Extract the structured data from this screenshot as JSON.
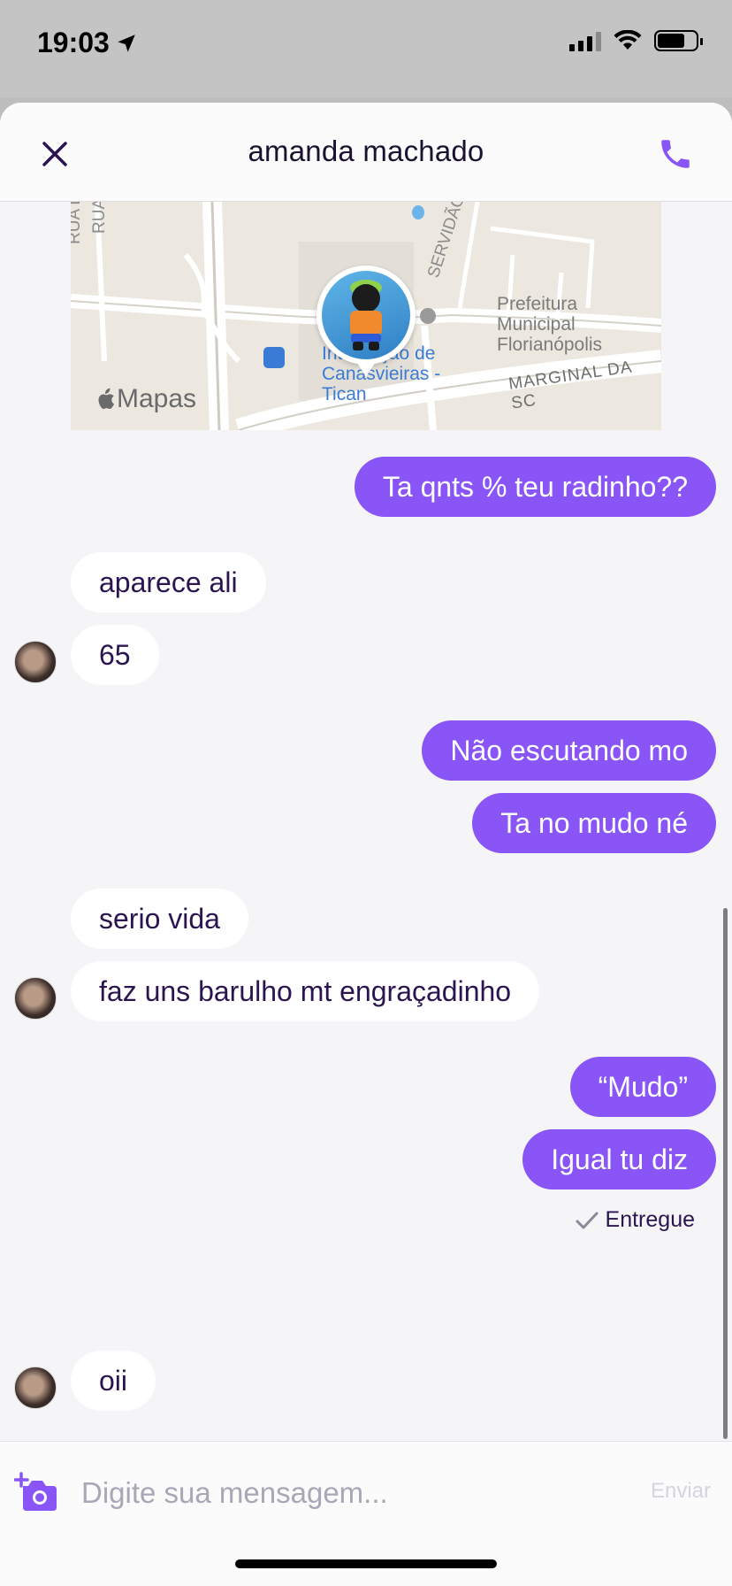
{
  "status_bar": {
    "time": "19:03"
  },
  "header": {
    "title": "amanda machado"
  },
  "map": {
    "streets": [
      "RUA L",
      "RUA",
      "SERVIDÃO B",
      "MARGINAL DA SC"
    ],
    "poi_lines": [
      "Prefeitura",
      "Municipal",
      "Florianópolis"
    ],
    "transit_lines": [
      "Integração de",
      "Canasvieiras -",
      "Tican"
    ],
    "watermark": "Mapas"
  },
  "messages": [
    {
      "side": "out",
      "text": "Ta qnts % teu radinho??"
    },
    {
      "side": "in",
      "text": "aparece ali"
    },
    {
      "side": "in",
      "text": "65"
    },
    {
      "side": "out",
      "text": "Não escutando mo"
    },
    {
      "side": "out",
      "text": "Ta no mudo né"
    },
    {
      "side": "in",
      "text": "serio vida"
    },
    {
      "side": "in",
      "text": "faz uns barulho mt engraçadinho"
    },
    {
      "side": "out",
      "text": "“Mudo”"
    },
    {
      "side": "out",
      "text": "Igual tu diz"
    },
    {
      "side": "in",
      "text": "oii"
    }
  ],
  "delivery_status": "Entregue",
  "composer": {
    "placeholder": "Digite sua mensagem...",
    "send_label": "Enviar"
  },
  "colors": {
    "accent": "#8a55f7",
    "text_dark": "#2b1550",
    "background": "#f5f5f7"
  },
  "icons": [
    "close-icon",
    "phone-icon",
    "camera-add-icon",
    "checkmark-icon",
    "location-arrow-icon",
    "apple-icon"
  ]
}
